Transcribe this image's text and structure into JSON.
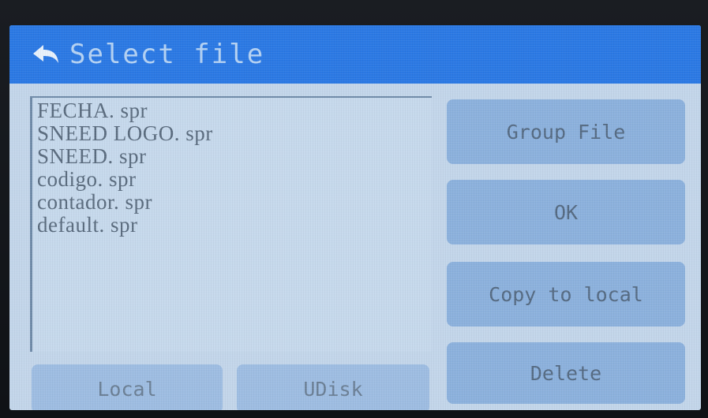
{
  "header": {
    "title": "Select file",
    "back_icon": "back-arrow-icon"
  },
  "files": [
    "FECHA. spr",
    "SNEED LOGO. spr",
    "SNEED. spr",
    "codigo. spr",
    "contador. spr",
    "default. spr"
  ],
  "actions": {
    "group_file": "Group File",
    "ok": "OK",
    "copy_to_local": "Copy to local",
    "delete": "Delete"
  },
  "storage": {
    "local": "Local",
    "udisk": "UDisk"
  },
  "colors": {
    "titlebar": "#2b79e4",
    "screen_bg": "#c3d6ea",
    "button_bg": "#8cb1dd",
    "text": "#556a82"
  }
}
